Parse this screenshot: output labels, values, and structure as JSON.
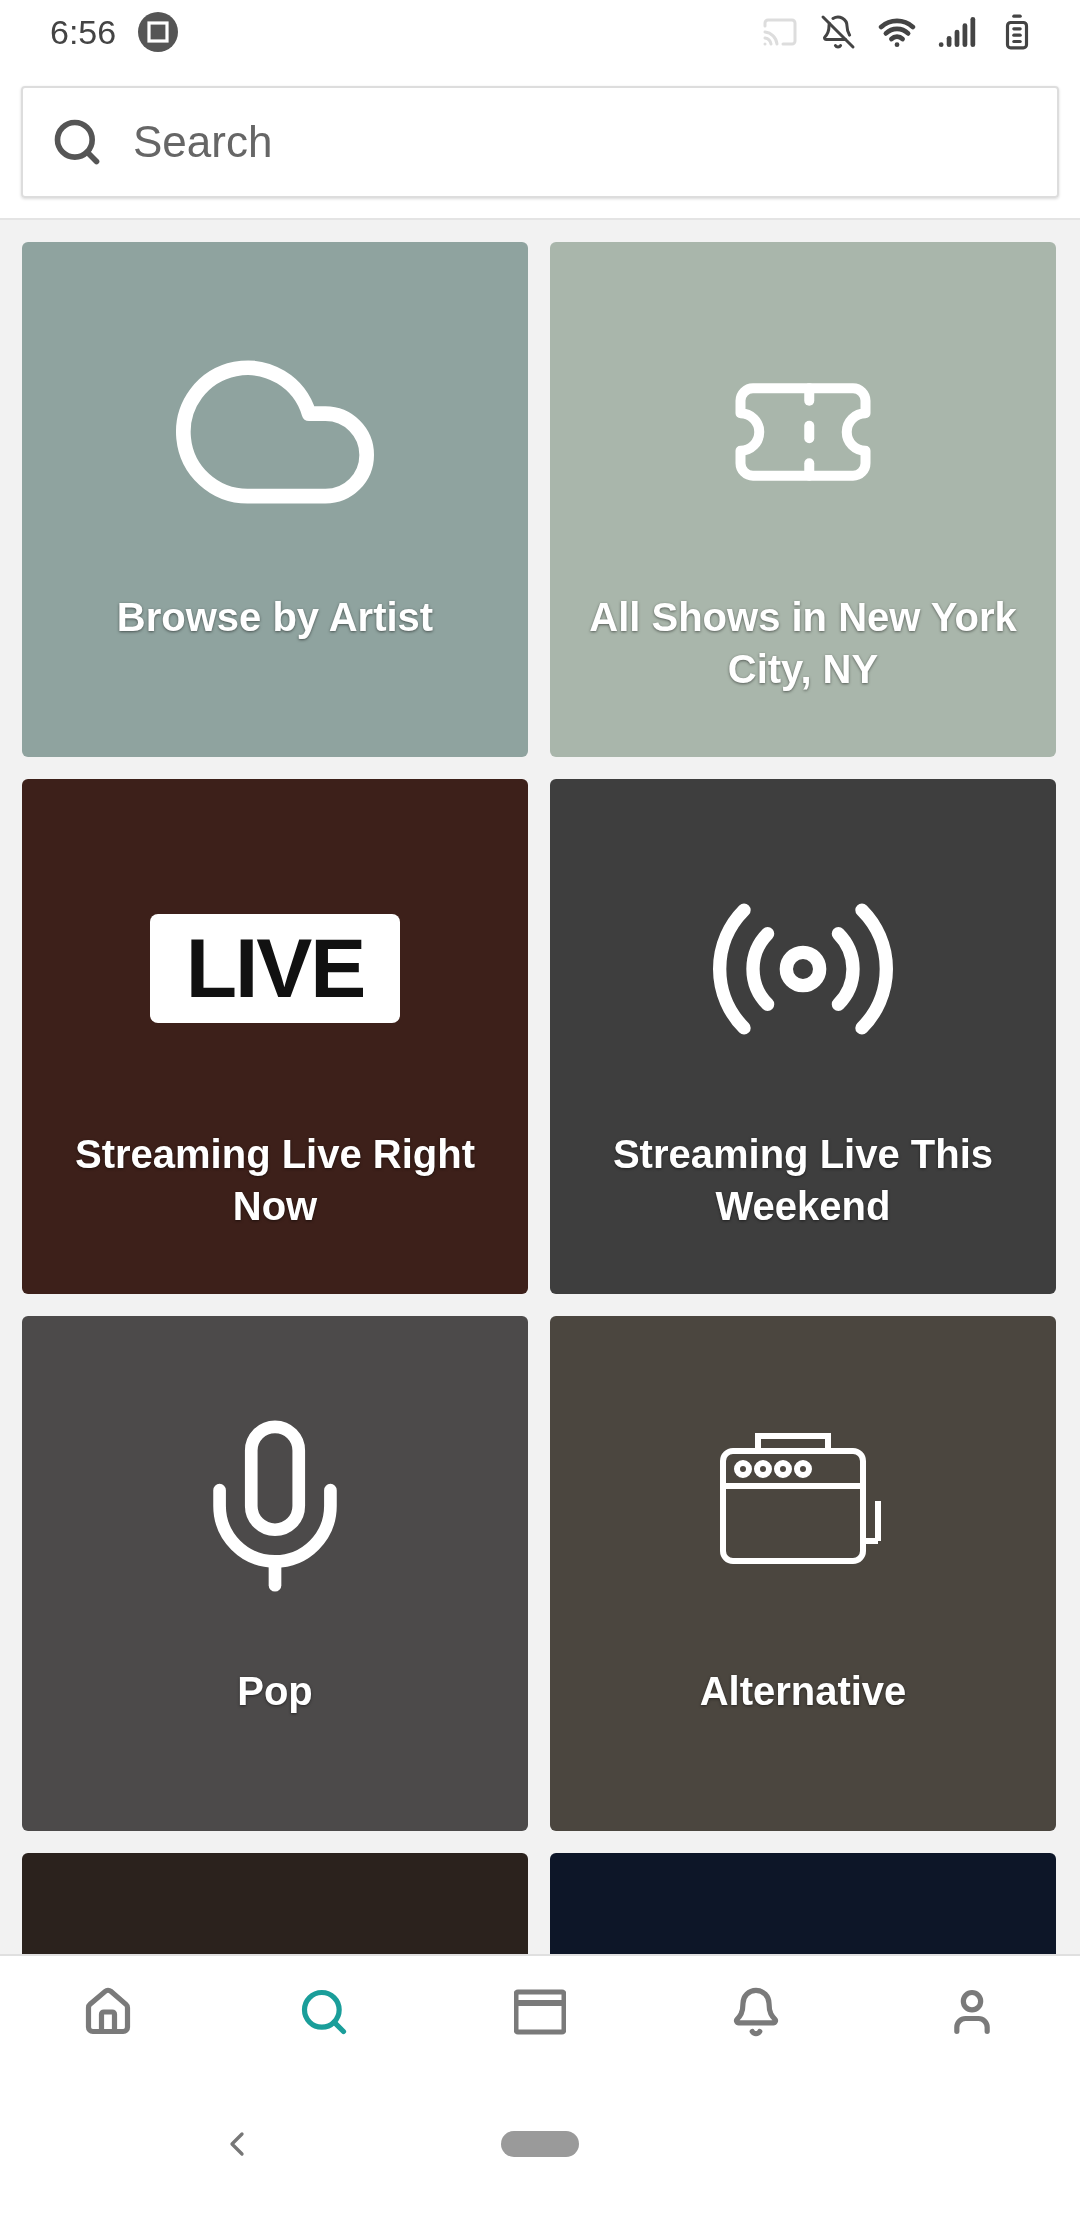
{
  "status_bar": {
    "time": "6:56"
  },
  "search": {
    "placeholder": "Search"
  },
  "tiles": [
    {
      "kind": "artists",
      "title": "Browse by Artist"
    },
    {
      "kind": "location",
      "title": "All Shows in New York City, NY"
    },
    {
      "kind": "live",
      "badge": "LIVE",
      "title": "Streaming Live Right Now"
    },
    {
      "kind": "broadcast",
      "title": "Streaming Live This Weekend"
    },
    {
      "kind": "mic",
      "title": "Pop"
    },
    {
      "kind": "amp",
      "title": "Alternative"
    },
    {
      "kind": "photo"
    },
    {
      "kind": "night"
    }
  ],
  "nav": [
    {
      "kind": "home",
      "selected": false
    },
    {
      "kind": "search",
      "selected": true
    },
    {
      "kind": "tickets",
      "selected": false
    },
    {
      "kind": "alerts",
      "selected": false
    },
    {
      "kind": "profile",
      "selected": false
    }
  ]
}
